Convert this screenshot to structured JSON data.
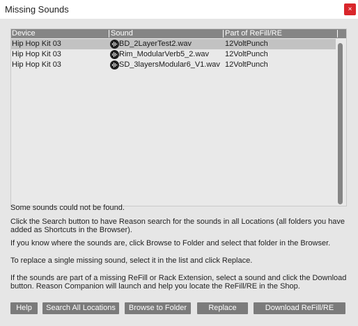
{
  "window": {
    "title": "Missing Sounds",
    "close_label": "×"
  },
  "table": {
    "headers": [
      "Device",
      "Sound",
      "Part of ReFill/RE"
    ],
    "rows": [
      {
        "device": "Hip Hop Kit 03",
        "sound": "BD_2LayerTest2.wav",
        "part": "12VoltPunch",
        "selected": true
      },
      {
        "device": "Hip Hop Kit 03",
        "sound": "Rim_ModularVerb5_2.wav",
        "part": "12VoltPunch",
        "selected": false
      },
      {
        "device": "Hip Hop Kit 03",
        "sound": "SD_3layersModular6_V1.wav",
        "part": "12VoltPunch",
        "selected": false
      }
    ],
    "sound_icon": "waveform-icon"
  },
  "messages": {
    "not_found": "Some sounds could not be found.",
    "search": "Click the Search button to have Reason search for the sounds in all Locations (all folders you have added as Shortcuts in the Browser).",
    "browse": "If you know where the sounds are, click Browse to Folder and select that folder in the Browser.",
    "replace": "To replace a single missing sound, select it in the list and click Replace.",
    "download": "If the sounds are part of a missing ReFill or Rack Extension, select a sound and click the Download button. Reason Companion will launch and help you locate the ReFill/RE in the Shop."
  },
  "buttons": {
    "help": "Help",
    "search_all": "Search All Locations",
    "browse": "Browse to Folder",
    "replace": "Replace",
    "download": "Download ReFill/RE"
  },
  "colors": {
    "header_bg": "#858585",
    "selected_row": "#c2c2c2",
    "button_bg": "#7b7b7b",
    "close_bg": "#d9262b"
  }
}
